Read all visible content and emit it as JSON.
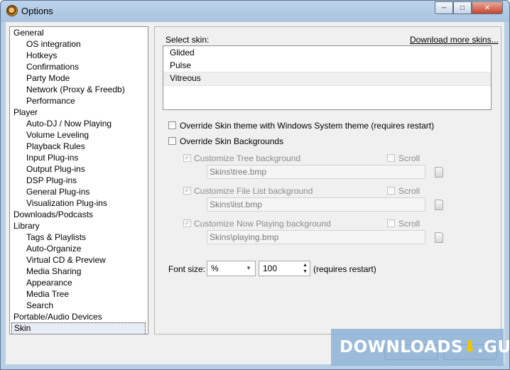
{
  "window": {
    "title": "Options"
  },
  "tree": {
    "items": [
      {
        "label": "General",
        "level": 0
      },
      {
        "label": "OS integration",
        "level": 1
      },
      {
        "label": "Hotkeys",
        "level": 1
      },
      {
        "label": "Confirmations",
        "level": 1
      },
      {
        "label": "Party Mode",
        "level": 1
      },
      {
        "label": "Network (Proxy & Freedb)",
        "level": 1
      },
      {
        "label": "Performance",
        "level": 1
      },
      {
        "label": "Player",
        "level": 0
      },
      {
        "label": "Auto-DJ / Now Playing",
        "level": 1
      },
      {
        "label": "Volume Leveling",
        "level": 1
      },
      {
        "label": "Playback Rules",
        "level": 1
      },
      {
        "label": "Input Plug-ins",
        "level": 1
      },
      {
        "label": "Output Plug-ins",
        "level": 1
      },
      {
        "label": "DSP Plug-ins",
        "level": 1
      },
      {
        "label": "General Plug-ins",
        "level": 1
      },
      {
        "label": "Visualization Plug-ins",
        "level": 1
      },
      {
        "label": "Downloads/Podcasts",
        "level": 0
      },
      {
        "label": "Library",
        "level": 0
      },
      {
        "label": "Tags & Playlists",
        "level": 1
      },
      {
        "label": "Auto-Organize",
        "level": 1
      },
      {
        "label": "Virtual CD & Preview",
        "level": 1
      },
      {
        "label": "Media Sharing",
        "level": 1
      },
      {
        "label": "Appearance",
        "level": 1
      },
      {
        "label": "Media Tree",
        "level": 1
      },
      {
        "label": "Search",
        "level": 1
      },
      {
        "label": "Portable/Audio Devices",
        "level": 0
      },
      {
        "label": "Skin",
        "level": 0,
        "selected": true
      }
    ]
  },
  "skin": {
    "select_label": "Select skin:",
    "download_link": "Download more skins...",
    "skins": [
      "Glided",
      "Pulse",
      "Vitreous"
    ],
    "selected_skin": "Vitreous",
    "override_theme": "Override Skin theme with Windows System theme (requires restart)",
    "override_backgrounds": "Override Skin Backgrounds",
    "tree_bg": {
      "label": "Customize Tree background",
      "scroll": "Scroll",
      "path": "Skins\\tree.bmp"
    },
    "filelist_bg": {
      "label": "Customize File List background",
      "scroll": "Scroll",
      "path": "Skins\\list.bmp"
    },
    "nowplaying_bg": {
      "label": "Customize Now Playing background",
      "scroll": "Scroll",
      "path": "Skins\\playing.bmp"
    },
    "font_size_label": "Font size:",
    "font_unit": "%",
    "font_value": "100",
    "requires_restart": "(requires restart)"
  },
  "watermark": {
    "text": "DOWNLOADS",
    "suffix": ".GURU",
    "icon": "download-arrow-icon"
  },
  "colors": {
    "title_bar": "#b9cfe6",
    "close_button": "#c7452c",
    "watermark_bg": "#8cb2d6"
  }
}
